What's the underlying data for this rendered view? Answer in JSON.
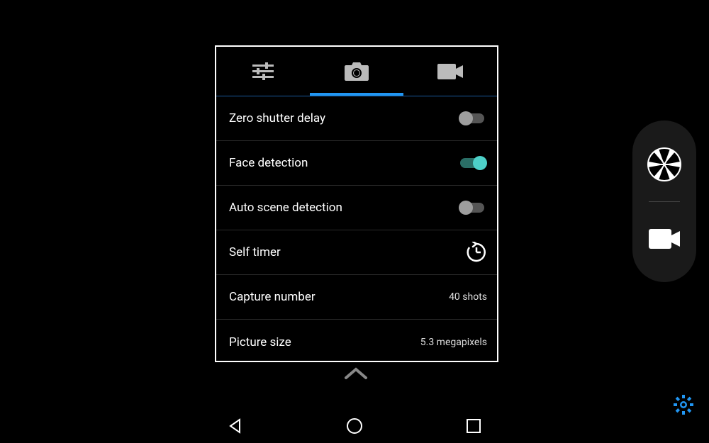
{
  "tabs": {
    "active_index": 1,
    "items": [
      "sliders",
      "photo",
      "video"
    ]
  },
  "settings": [
    {
      "label": "Zero shutter delay",
      "type": "toggle",
      "on": false
    },
    {
      "label": "Face detection",
      "type": "toggle",
      "on": true
    },
    {
      "label": "Auto scene detection",
      "type": "toggle",
      "on": false
    },
    {
      "label": "Self timer",
      "type": "icon",
      "icon": "timer"
    },
    {
      "label": "Capture number",
      "type": "value",
      "value": "40 shots"
    },
    {
      "label": "Picture size",
      "type": "value",
      "value": "5.3 megapixels"
    }
  ],
  "side": {
    "shutter": "shutter",
    "video": "video"
  },
  "colors": {
    "accent": "#2196f3",
    "toggle_on": "#4dd0c8",
    "gear": "#2196f3"
  }
}
